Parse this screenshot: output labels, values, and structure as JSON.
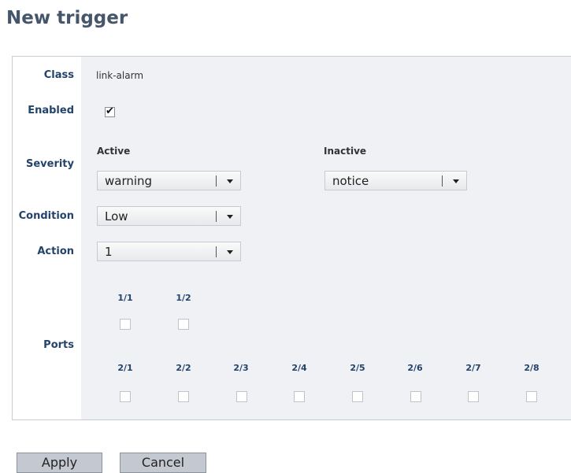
{
  "title": "New trigger",
  "form": {
    "class_label": "Class",
    "class_value": "link-alarm",
    "enabled_label": "Enabled",
    "enabled_checked": true,
    "severity_label": "Severity",
    "active_label": "Active",
    "inactive_label": "Inactive",
    "active_value": "warning",
    "inactive_value": "notice",
    "condition_label": "Condition",
    "condition_value": "Low",
    "action_label": "Action",
    "action_value": "1",
    "ports_label": "Ports",
    "ports_row1": [
      "1/1",
      "1/2"
    ],
    "ports_row2": [
      "2/1",
      "2/2",
      "2/3",
      "2/4",
      "2/5",
      "2/6",
      "2/7",
      "2/8"
    ]
  },
  "buttons": {
    "apply": "Apply",
    "cancel": "Cancel"
  },
  "icons": {
    "enabled_check": "checkmark-icon",
    "dropdown": "chevron-down-icon"
  }
}
